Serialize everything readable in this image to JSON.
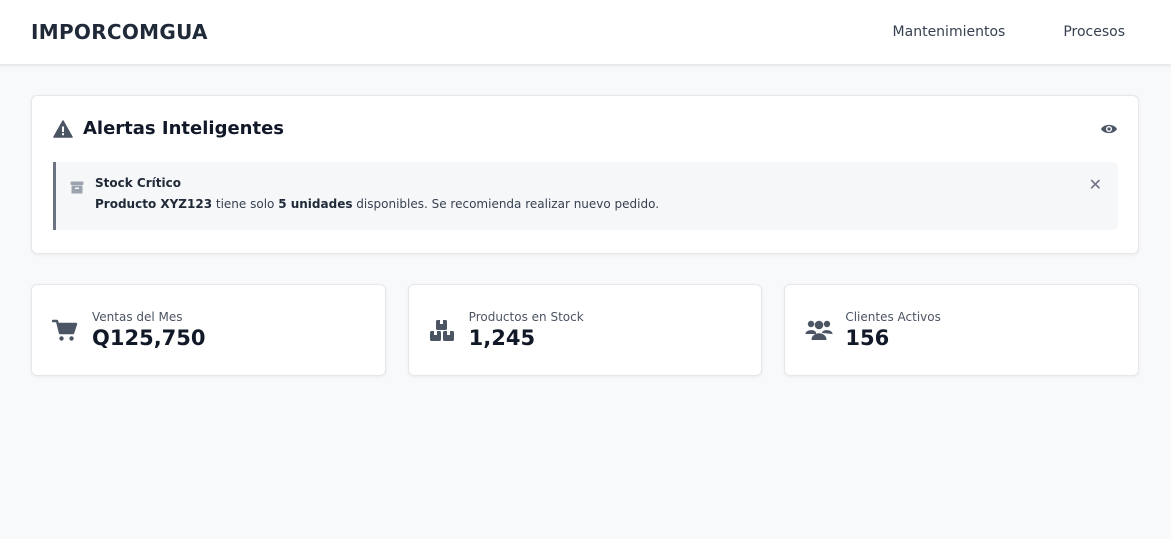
{
  "navbar": {
    "brand": "IMPORCOMGUA",
    "links": [
      {
        "label": "Mantenimientos"
      },
      {
        "label": "Procesos"
      }
    ]
  },
  "alerts": {
    "title": "Alertas Inteligentes",
    "title_icon": "warning-triangle-icon",
    "toggle_icon": "eye-icon",
    "items": [
      {
        "icon": "box-icon",
        "title": "Stock Crítico",
        "product": "Producto XYZ123",
        "text_1": " tiene solo ",
        "quantity": "5 unidades",
        "text_2": " disponibles. Se recomienda realizar nuevo pedido.",
        "close_icon": "close-icon",
        "close_glyph": "✕"
      }
    ]
  },
  "stats": [
    {
      "icon": "shopping-cart-icon",
      "label": "Ventas del Mes",
      "value": "Q125,750"
    },
    {
      "icon": "boxes-icon",
      "label": "Productos en Stock",
      "value": "1,245"
    },
    {
      "icon": "users-icon",
      "label": "Clientes Activos",
      "value": "156"
    }
  ],
  "colors": {
    "background": "#f8f9fb",
    "card": "#ffffff",
    "icon": "#4b5563",
    "alert_border": "#6b7280"
  }
}
